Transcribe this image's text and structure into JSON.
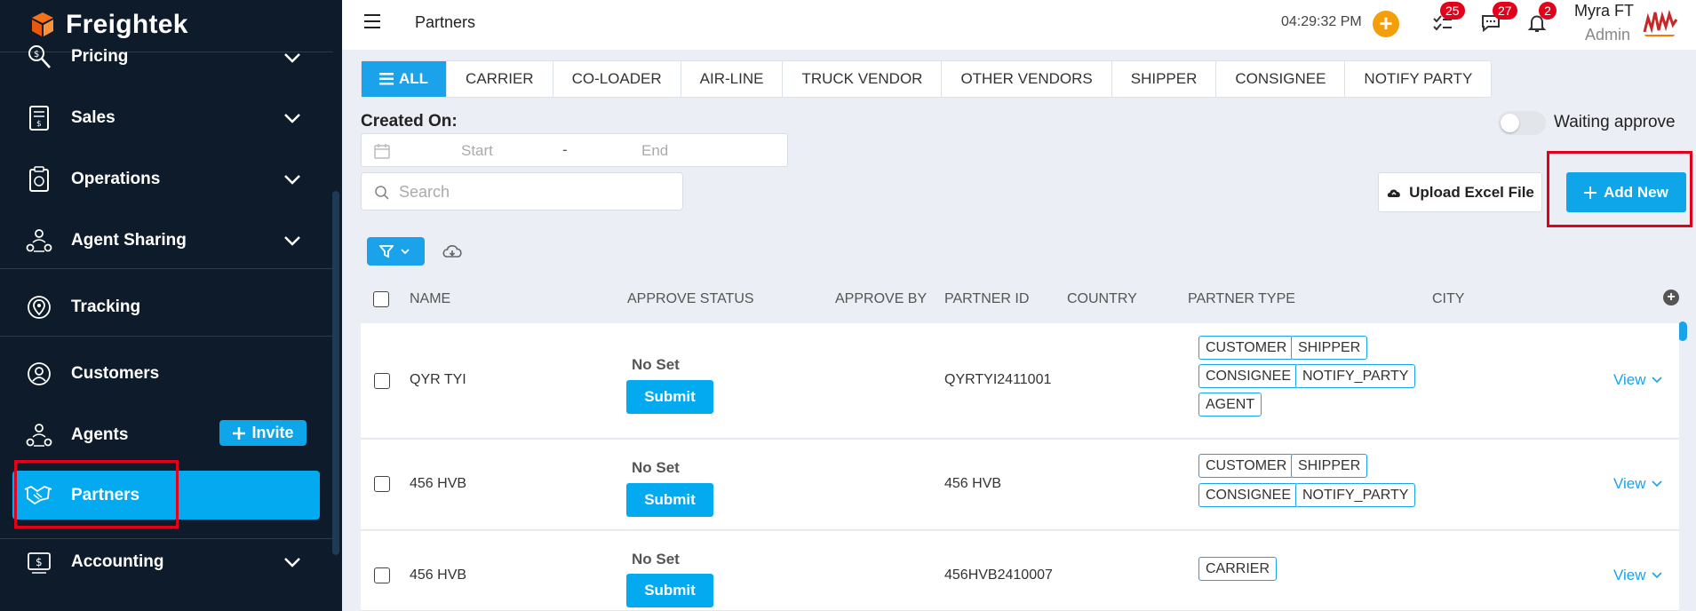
{
  "brand": {
    "name": "Freightek"
  },
  "sidebar": {
    "items": [
      {
        "label": "Pricing"
      },
      {
        "label": "Sales"
      },
      {
        "label": "Operations"
      },
      {
        "label": "Agent Sharing"
      },
      {
        "label": "Tracking"
      },
      {
        "label": "Customers"
      },
      {
        "label": "Agents"
      },
      {
        "label": "Partners"
      },
      {
        "label": "Accounting"
      }
    ],
    "invite_label": "Invite"
  },
  "topbar": {
    "title": "Partners",
    "clock": "04:29:32 PM",
    "tasks_count": "25",
    "messages_count": "27",
    "notifications_count": "2",
    "user_name": "Myra FT",
    "user_role": "Admin"
  },
  "tabs": [
    {
      "label": "ALL"
    },
    {
      "label": "CARRIER"
    },
    {
      "label": "CO-LOADER"
    },
    {
      "label": "AIR-LINE"
    },
    {
      "label": "TRUCK VENDOR"
    },
    {
      "label": "OTHER VENDORS"
    },
    {
      "label": "SHIPPER"
    },
    {
      "label": "CONSIGNEE"
    },
    {
      "label": "NOTIFY PARTY"
    }
  ],
  "filters": {
    "created_on_label": "Created On:",
    "start_placeholder": "Start",
    "range_separator": "-",
    "end_placeholder": "End",
    "search_placeholder": "Search",
    "waiting_approve_label": "Waiting approve",
    "waiting_approve_on": false
  },
  "actions": {
    "upload_label": "Upload Excel File",
    "add_new_label": "Add New"
  },
  "table": {
    "columns": [
      "NAME",
      "APPROVE STATUS",
      "APPROVE BY",
      "PARTNER ID",
      "COUNTRY",
      "PARTNER TYPE",
      "CITY"
    ],
    "rows": [
      {
        "name": "QYR TYI",
        "status": "No Set",
        "submit": "Submit",
        "partner_id": "QYRTYI2411001",
        "types": [
          "CUSTOMER",
          "SHIPPER",
          "CONSIGNEE",
          "NOTIFY_PARTY",
          "AGENT"
        ],
        "view": "View"
      },
      {
        "name": "456 HVB",
        "status": "No Set",
        "submit": "Submit",
        "partner_id": "456 HVB",
        "types": [
          "CUSTOMER",
          "SHIPPER",
          "CONSIGNEE",
          "NOTIFY_PARTY"
        ],
        "view": "View"
      },
      {
        "name": "456 HVB",
        "status": "No Set",
        "submit": "Submit",
        "partner_id": "456HVB2410007",
        "types": [
          "CARRIER"
        ],
        "view": "View"
      }
    ]
  },
  "colors": {
    "sidebar_bg": "#0d1b2a",
    "accent": "#1aa3ea",
    "active_item": "#04aaf0",
    "badge": "#e3001b",
    "highlight_box": "#e3001b"
  }
}
